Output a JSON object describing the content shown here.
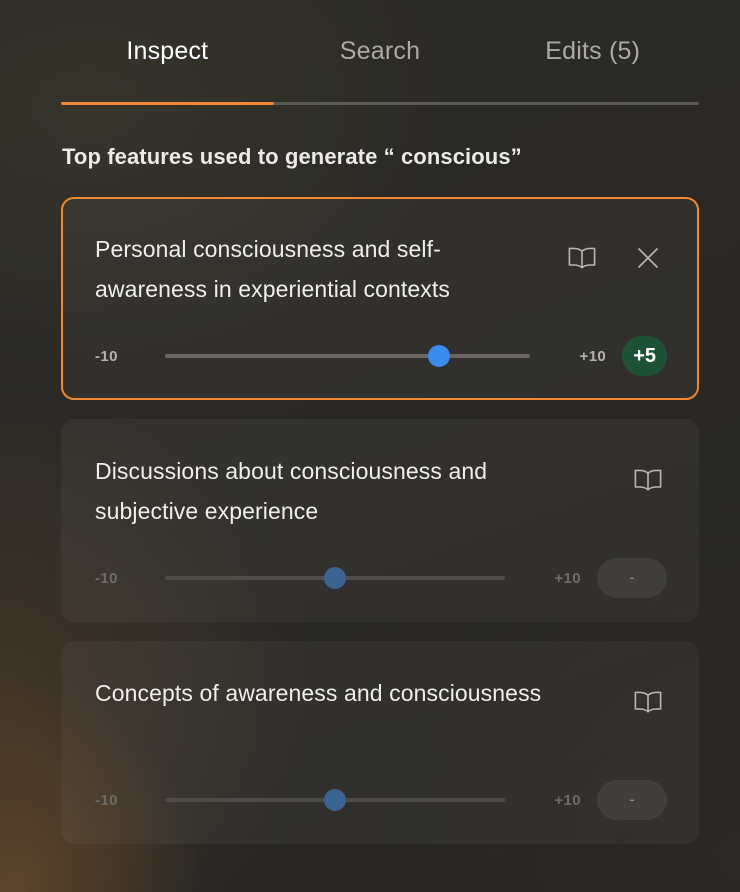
{
  "colors": {
    "accent_orange": "#ef8833",
    "slider_blue": "#3b8ced",
    "slider_blue_dim": "#3c6492",
    "badge_green": "#1e5235",
    "background": "#272622",
    "text_primary": "#f0eeea",
    "text_muted": "#adaaa4"
  },
  "tabs": [
    {
      "label": "Inspect",
      "active": true
    },
    {
      "label": "Search",
      "active": false
    },
    {
      "label": "Edits (5)",
      "active": false
    }
  ],
  "heading": "Top features used to generate “ conscious”",
  "features": [
    {
      "title": "Personal consciousness and self-awareness in experiential contexts",
      "selected": true,
      "min_label": "-10",
      "max_label": "+10",
      "min_value": -10,
      "max_value": 10,
      "value": 5,
      "badge_label": "+5",
      "badge_state": "active",
      "book_icon": "book-icon",
      "close_icon": "close-icon",
      "has_close": true
    },
    {
      "title": "Discussions about consciousness and subjective experience",
      "selected": false,
      "min_label": "-10",
      "max_label": "+10",
      "min_value": -10,
      "max_value": 10,
      "value": 0,
      "badge_label": "-",
      "badge_state": "empty",
      "book_icon": "book-icon",
      "has_close": false
    },
    {
      "title": "Concepts of awareness and consciousness",
      "selected": false,
      "min_label": "-10",
      "max_label": "+10",
      "min_value": -10,
      "max_value": 10,
      "value": 0,
      "badge_label": "-",
      "badge_state": "empty",
      "book_icon": "book-icon",
      "has_close": false
    }
  ]
}
